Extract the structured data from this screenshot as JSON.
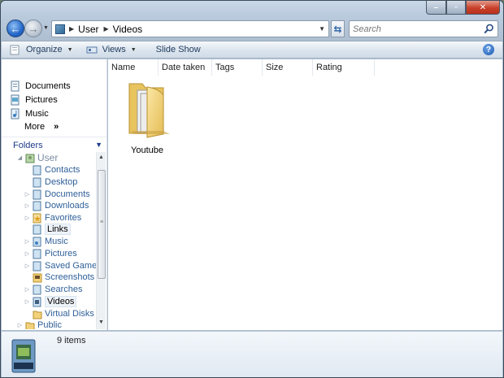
{
  "window": {
    "caption_buttons": [
      {
        "name": "minimize",
        "glyph": "–"
      },
      {
        "name": "maximize",
        "glyph": "▫"
      },
      {
        "name": "close",
        "glyph": "✕"
      }
    ]
  },
  "address_bar": {
    "crumbs": [
      "User",
      "Videos"
    ]
  },
  "search": {
    "placeholder": "Search"
  },
  "toolbar": {
    "organize_label": "Organize",
    "views_label": "Views",
    "slideshow_label": "Slide Show"
  },
  "favorites": {
    "items": [
      {
        "label": "Documents",
        "icon": "documents-icon"
      },
      {
        "label": "Pictures",
        "icon": "pictures-icon"
      },
      {
        "label": "Music",
        "icon": "music-icon"
      }
    ],
    "more_label": "More",
    "more_glyph": "»"
  },
  "folders_header": {
    "label": "Folders"
  },
  "tree": {
    "items": [
      {
        "label": "User",
        "level": 1,
        "expander": "◢",
        "selected": false
      },
      {
        "label": "Contacts",
        "level": 2,
        "expander": "",
        "selected": false
      },
      {
        "label": "Desktop",
        "level": 2,
        "expander": "",
        "selected": false
      },
      {
        "label": "Documents",
        "level": 2,
        "expander": "▷",
        "selected": false
      },
      {
        "label": "Downloads",
        "level": 2,
        "expander": "▷",
        "selected": false
      },
      {
        "label": "Favorites",
        "level": 2,
        "expander": "▷",
        "selected": false
      },
      {
        "label": "Links",
        "level": 2,
        "expander": "",
        "selected": true
      },
      {
        "label": "Music",
        "level": 2,
        "expander": "▷",
        "selected": false
      },
      {
        "label": "Pictures",
        "level": 2,
        "expander": "▷",
        "selected": false
      },
      {
        "label": "Saved Games",
        "level": 2,
        "expander": "▷",
        "selected": false
      },
      {
        "label": "Screenshots",
        "level": 2,
        "expander": "",
        "selected": false
      },
      {
        "label": "Searches",
        "level": 2,
        "expander": "▷",
        "selected": false
      },
      {
        "label": "Videos",
        "level": 2,
        "expander": "▷",
        "selected": true
      },
      {
        "label": "Virtual Disks",
        "level": 2,
        "expander": "",
        "selected": false
      },
      {
        "label": "Public",
        "level": 1,
        "expander": "▷",
        "selected": false
      }
    ]
  },
  "columns": [
    "Name",
    "Date taken",
    "Tags",
    "Size",
    "Rating"
  ],
  "files": [
    {
      "name": "Youtube",
      "type": "folder"
    }
  ],
  "details": {
    "count_label": "9 items"
  }
}
